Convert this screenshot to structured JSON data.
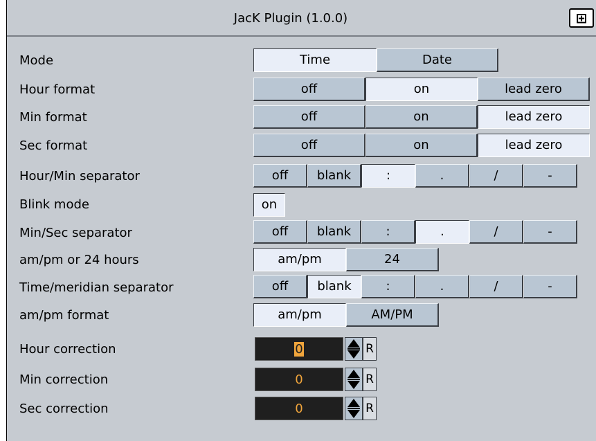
{
  "window": {
    "title": "JacK Plugin (1.0.0)",
    "icon": "plugin-icon"
  },
  "rows": {
    "mode": {
      "label": "Mode",
      "options": [
        "Time",
        "Date"
      ],
      "selected": "Time"
    },
    "hour_format": {
      "label": "Hour format",
      "options": [
        "off",
        "on",
        "lead zero"
      ],
      "selected": "on"
    },
    "min_format": {
      "label": "Min format",
      "options": [
        "off",
        "on",
        "lead zero"
      ],
      "selected": "lead zero"
    },
    "sec_format": {
      "label": "Sec format",
      "options": [
        "off",
        "on",
        "lead zero"
      ],
      "selected": "lead zero"
    },
    "hour_min_sep": {
      "label": "Hour/Min separator",
      "options": [
        "off",
        "blank",
        ":",
        ".",
        "/",
        "-"
      ],
      "selected": ":"
    },
    "blink_mode": {
      "label": "Blink mode",
      "value": "on"
    },
    "min_sec_sep": {
      "label": "Min/Sec separator",
      "options": [
        "off",
        "blank",
        ":",
        ".",
        "/",
        "-"
      ],
      "selected": "."
    },
    "ampm_24": {
      "label": "am/pm or 24 hours",
      "options": [
        "am/pm",
        "24"
      ],
      "selected": "am/pm"
    },
    "time_meridian_sep": {
      "label": "Time/meridian separator",
      "options": [
        "off",
        "blank",
        ":",
        ".",
        "/",
        "-"
      ],
      "selected": "blank"
    },
    "ampm_format": {
      "label": "am/pm format",
      "options": [
        "am/pm",
        "AM/PM"
      ],
      "selected": "am/pm"
    },
    "hour_correction": {
      "label": "Hour correction",
      "value": "0",
      "reset": "R"
    },
    "min_correction": {
      "label": "Min correction",
      "value": "0",
      "reset": "R"
    },
    "sec_correction": {
      "label": "Sec correction",
      "value": "0",
      "reset": "R"
    }
  },
  "colors": {
    "panel": "#c6cbd1",
    "button": "#b9c6d3",
    "selected": "#e9eef8",
    "numeric_bg": "#1f1f1f",
    "numeric_fg": "#f0a53c"
  }
}
